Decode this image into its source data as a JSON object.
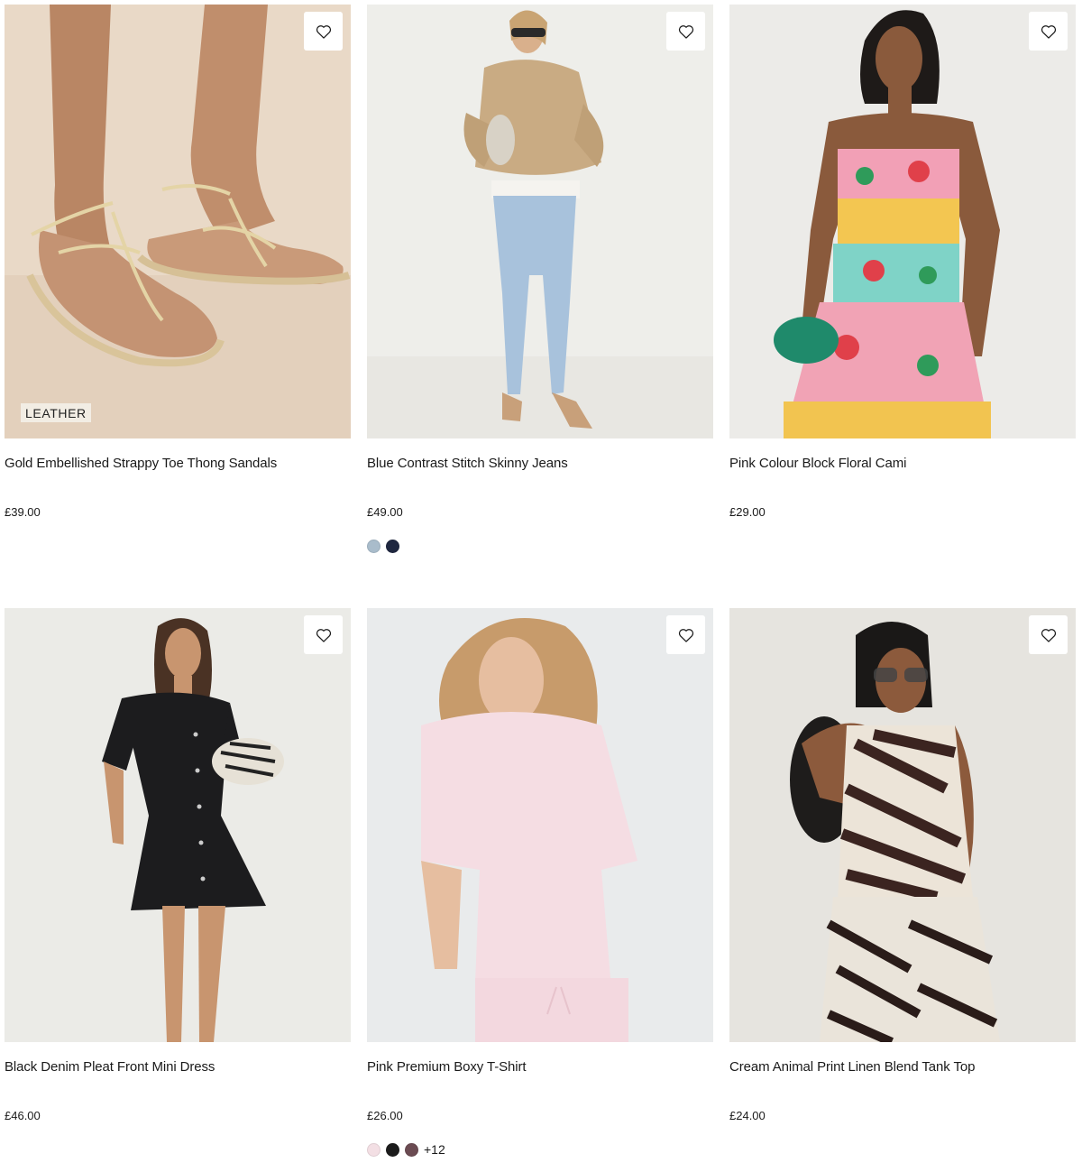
{
  "products": [
    {
      "title": "Gold Embellished Strappy Toe Thong Sandals",
      "price": "£39.00",
      "badge": "LEATHER",
      "favourite_icon": "heart-outline-icon",
      "swatches": [],
      "more_colours": ""
    },
    {
      "title": "Blue Contrast Stitch Skinny Jeans",
      "price": "£49.00",
      "badge": "",
      "favourite_icon": "heart-outline-icon",
      "swatches": [
        "#a9bccb",
        "#1f2740"
      ],
      "more_colours": ""
    },
    {
      "title": "Pink Colour Block Floral Cami",
      "price": "£29.00",
      "badge": "",
      "favourite_icon": "heart-outline-icon",
      "swatches": [],
      "more_colours": ""
    },
    {
      "title": "Black Denim Pleat Front Mini Dress",
      "price": "£46.00",
      "badge": "",
      "favourite_icon": "heart-outline-icon",
      "swatches": [],
      "more_colours": ""
    },
    {
      "title": "Pink Premium Boxy T-Shirt",
      "price": "£26.00",
      "badge": "",
      "favourite_icon": "heart-outline-icon",
      "swatches": [
        "#f3dfe4",
        "#1c1c1c",
        "#6b4b52"
      ],
      "more_colours": "+12"
    },
    {
      "title": "Cream Animal Print Linen Blend Tank Top",
      "price": "£24.00",
      "badge": "",
      "favourite_icon": "heart-outline-icon",
      "swatches": [],
      "more_colours": ""
    }
  ]
}
